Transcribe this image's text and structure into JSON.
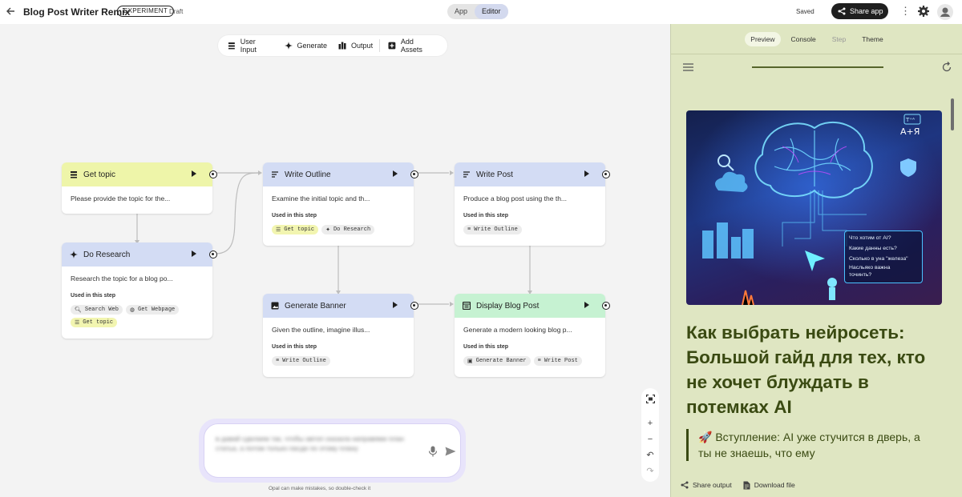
{
  "header": {
    "title": "Blog Post Writer Remix",
    "badge": "EXPERIMENT",
    "status": "Draft",
    "mode_tabs": [
      "App",
      "Editor"
    ],
    "active_mode": "Editor",
    "save_status": "Saved",
    "share_label": "Share app",
    "icons": [
      "back-arrow-icon",
      "kebab-menu-icon",
      "gear-icon",
      "avatar"
    ]
  },
  "toolbar": {
    "items": [
      {
        "label": "User Input",
        "icon": "user-input-icon"
      },
      {
        "label": "Generate",
        "icon": "sparkle-icon"
      },
      {
        "label": "Output",
        "icon": "output-icon"
      },
      {
        "label": "Add Assets",
        "icon": "add-box-icon"
      }
    ]
  },
  "nodes": {
    "get_topic": {
      "title": "Get topic",
      "desc": "Please provide the topic for the...",
      "color": "#eef5a9"
    },
    "do_research": {
      "title": "Do Research",
      "desc": "Research the topic for a blog po...",
      "used_label": "Used in this step",
      "chips": [
        "Search Web",
        "Get Webpage",
        "Get topic"
      ],
      "color": "#d3dcf4"
    },
    "write_outline": {
      "title": "Write Outline",
      "desc": "Examine the initial topic and th...",
      "used_label": "Used in this step",
      "chips": [
        "Get topic",
        "Do Research"
      ],
      "color": "#d3dcf4"
    },
    "write_post": {
      "title": "Write Post",
      "desc": "Produce a blog post using the th...",
      "used_label": "Used in this step",
      "chips": [
        "Write Outline"
      ],
      "color": "#d3dcf4"
    },
    "generate_banner": {
      "title": "Generate Banner",
      "desc": "Given the outline, imagine illus...",
      "used_label": "Used in this step",
      "chips": [
        "Write Outline"
      ],
      "color": "#d3dcf4"
    },
    "display_blog_post": {
      "title": "Display Blog Post",
      "desc": "Generate a modern looking blog p...",
      "used_label": "Used in this step",
      "chips": [
        "Generate Banner",
        "Write Post"
      ],
      "color": "#c6f2d2"
    }
  },
  "prompt": {
    "text": "в давай сделаем так, чтобы автоп сказала направями план статьа, а потом только пасде по этому плану",
    "disclaimer": "Opal can make mistakes, so double-check it"
  },
  "zoom_controls": [
    "fit-icon",
    "zoom-in-icon",
    "zoom-out-icon",
    "undo-icon",
    "redo-icon"
  ],
  "panel": {
    "tabs": [
      "Preview",
      "Console",
      "Step",
      "Theme"
    ],
    "active_tab": "Preview",
    "progress": 1.0,
    "hero_questions": [
      "Что хотим от AI?",
      "Какие данны есть?",
      "Сколько в уна \"железа\"",
      "Насльяко важна",
      "точинть?"
    ],
    "hero_badges": [
      "T⁺ᴬ",
      "A+Я"
    ],
    "article_title": "Как выбрать нейросеть: Большой гайд для тех, кто не хочет блуждать в потемках AI",
    "intro": "🚀 Вступление: AI уже стучится в дверь, а ты не знаешь, что ему",
    "share_output": "Share output",
    "download_file": "Download file"
  },
  "colors": {
    "accent_dark": "#1f1f1f",
    "panel_bg": "#dfe6c2",
    "article_text": "#3a4a12",
    "node_blue": "#d3dcf4",
    "node_yellow": "#eef5a9",
    "node_green": "#c6f2d2"
  }
}
